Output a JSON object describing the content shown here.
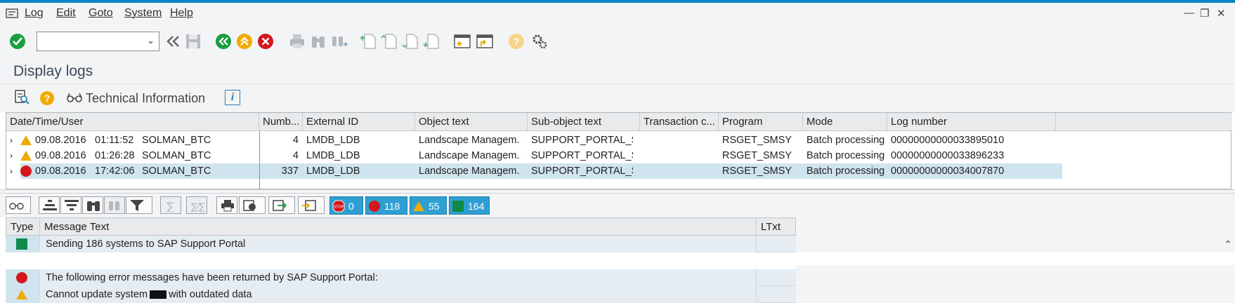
{
  "menu": {
    "items": [
      "Log",
      "Edit",
      "Goto",
      "System",
      "Help"
    ]
  },
  "window_controls": [
    "―",
    "❐",
    "✕"
  ],
  "toolbar": {
    "command_value": "",
    "icons": [
      "enter-icon",
      "back-icon",
      "save-icon",
      "back-green-icon",
      "exit-icon",
      "cancel-icon",
      "print-icon",
      "find-icon",
      "find-next-icon",
      "first-page-icon",
      "prev-page-icon",
      "next-page-icon",
      "last-page-icon",
      "new-session-icon",
      "shortcut-icon",
      "help-icon",
      "settings-icon"
    ]
  },
  "title": "Display logs",
  "app_toolbar": {
    "technical_information": "Technical Information",
    "info_icon": "i"
  },
  "log_grid": {
    "columns": [
      "Date/Time/User",
      "Numb...",
      "External ID",
      "Object text",
      "Sub-object text",
      "Transaction c...",
      "Program",
      "Mode",
      "Log number"
    ],
    "rows": [
      {
        "status": "warning",
        "date": "09.08.2016",
        "time": "01:11:52",
        "user": "SOLMAN_BTC",
        "number": "4",
        "external_id": "LMDB_LDB",
        "object_text": "Landscape Managem...",
        "sub_object_text": "SUPPORT_PORTAL_SY...",
        "transaction": "",
        "program": "RSGET_SMSY",
        "mode": "Batch processing",
        "log_number": "00000000000033895010"
      },
      {
        "status": "warning",
        "date": "09.08.2016",
        "time": "01:26:28",
        "user": "SOLMAN_BTC",
        "number": "4",
        "external_id": "LMDB_LDB",
        "object_text": "Landscape Managem...",
        "sub_object_text": "SUPPORT_PORTAL_SY...",
        "transaction": "",
        "program": "RSGET_SMSY",
        "mode": "Batch processing",
        "log_number": "00000000000033896233"
      },
      {
        "status": "error",
        "date": "09.08.2016",
        "time": "17:42:06",
        "user": "SOLMAN_BTC",
        "number": "337",
        "external_id": "LMDB_LDB",
        "object_text": "Landscape Managem...",
        "sub_object_text": "SUPPORT_PORTAL_SY...",
        "transaction": "",
        "program": "RSGET_SMSY",
        "mode": "Batch processing",
        "log_number": "00000000000034007870"
      }
    ]
  },
  "message_toolbar": {
    "counters": [
      {
        "type": "stop",
        "count": "0"
      },
      {
        "type": "error",
        "count": "118"
      },
      {
        "type": "warning",
        "count": "55"
      },
      {
        "type": "success",
        "count": "164"
      }
    ]
  },
  "message_grid": {
    "columns": [
      "Type",
      "Message Text",
      "LTxt"
    ],
    "rows": [
      {
        "type": "success",
        "text": "Sending 186 systems to SAP Support Portal"
      },
      {
        "type": "error",
        "text": "The following error messages have been returned by SAP Support Portal:"
      },
      {
        "type": "warning",
        "text_before": "Cannot update system",
        "text_after": "with outdated data"
      }
    ]
  },
  "colors": {
    "accent": "#0a84c9",
    "selected_row": "#cfe4ee",
    "counter_bg": "#2f9fd3",
    "error": "#d4161b",
    "warning": "#f0ab00",
    "success": "#108a4a"
  }
}
